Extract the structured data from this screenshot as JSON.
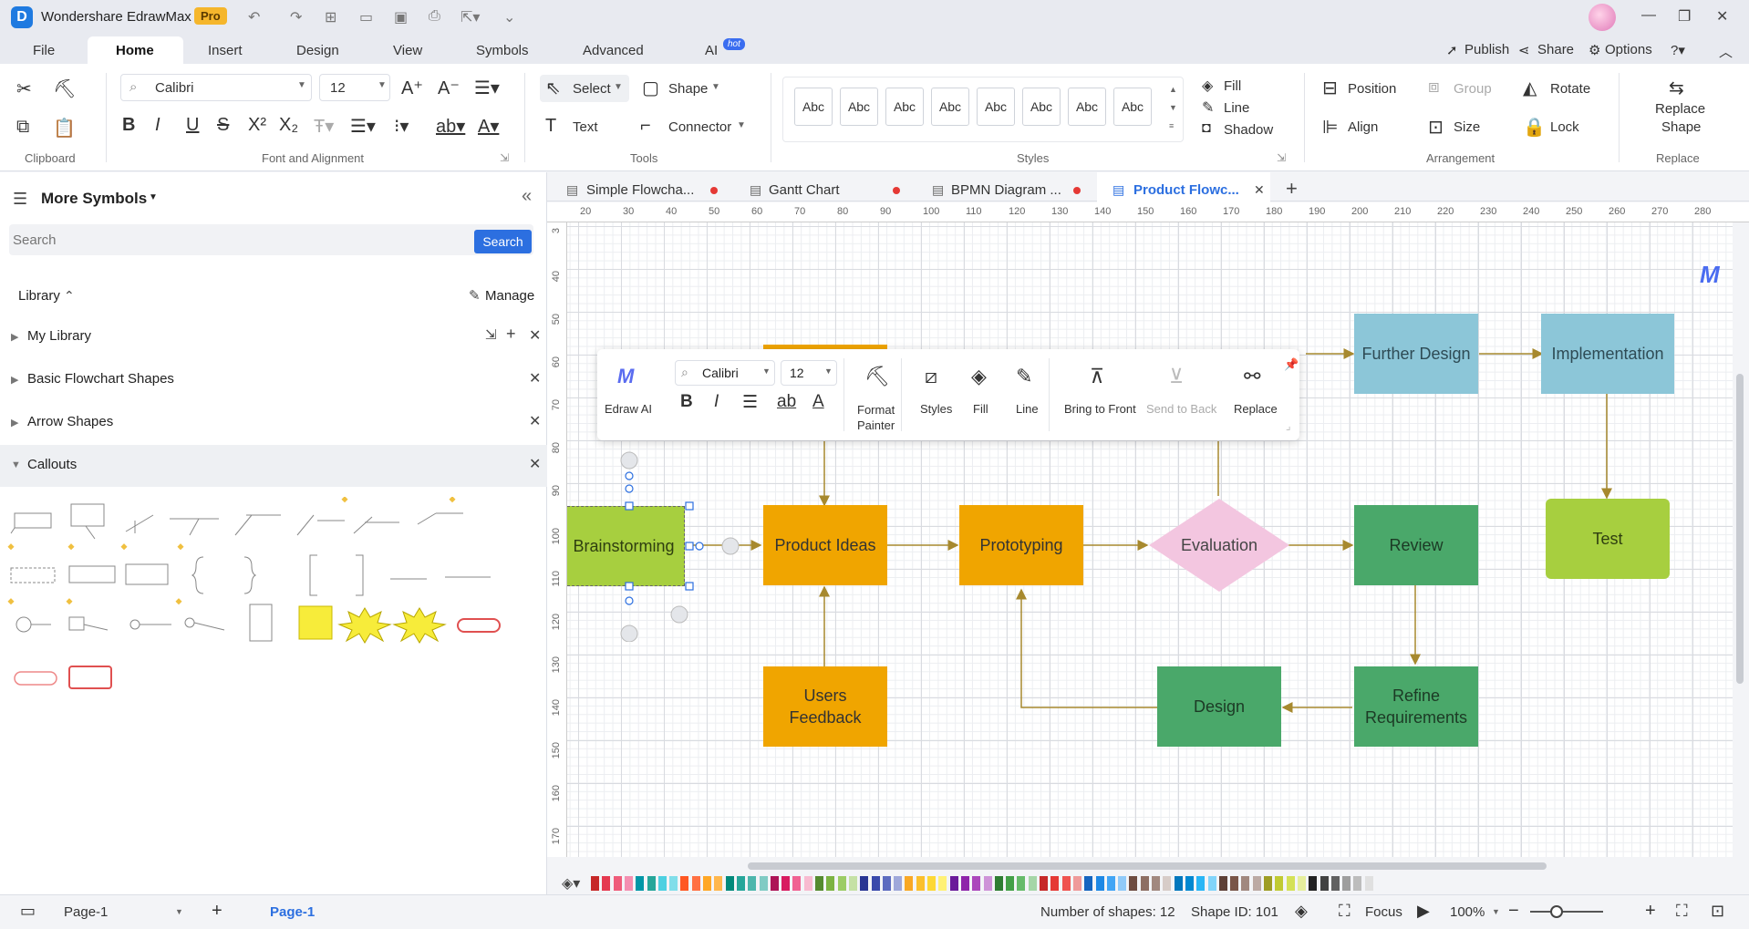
{
  "app": {
    "title": "Wondershare EdrawMax",
    "badge": "Pro"
  },
  "menu": {
    "tabs": [
      "File",
      "Home",
      "Insert",
      "Design",
      "View",
      "Symbols",
      "Advanced",
      "AI"
    ],
    "ai_badge": "hot",
    "publish": "Publish",
    "share": "Share",
    "options": "Options"
  },
  "ribbon": {
    "font_name": "Calibri",
    "font_size": "12",
    "select_label": "Select",
    "shape_label": "Shape",
    "text_label": "Text",
    "connector_label": "Connector",
    "style_sample": "Abc",
    "fill_label": "Fill",
    "line_label": "Line",
    "shadow_label": "Shadow",
    "position_label": "Position",
    "group_label": "Group",
    "rotate_label": "Rotate",
    "align_label": "Align",
    "size_label": "Size",
    "lock_label": "Lock",
    "replace_shape_1": "Replace",
    "replace_shape_2": "Shape",
    "groups": {
      "clipboard": "Clipboard",
      "font": "Font and Alignment",
      "tools": "Tools",
      "styles": "Styles",
      "arrangement": "Arrangement",
      "replace": "Replace"
    }
  },
  "left_panel": {
    "title": "More Symbols",
    "search_placeholder": "Search",
    "search_button": "Search",
    "library_label": "Library",
    "manage_label": "Manage",
    "items": [
      {
        "label": "My Library"
      },
      {
        "label": "Basic Flowchart Shapes"
      },
      {
        "label": "Arrow Shapes"
      },
      {
        "label": "Callouts"
      }
    ]
  },
  "doc_tabs": [
    {
      "label": "Simple Flowcha..."
    },
    {
      "label": "Gantt Chart"
    },
    {
      "label": "BPMN Diagram ..."
    },
    {
      "label": "Product Flowc..."
    }
  ],
  "ruler": {
    "h": [
      "20",
      "30",
      "40",
      "50",
      "60",
      "70",
      "80",
      "90",
      "100",
      "110",
      "120",
      "130",
      "140",
      "150",
      "160",
      "170",
      "180",
      "190",
      "200",
      "210",
      "220",
      "230",
      "240",
      "250",
      "260",
      "270",
      "280"
    ],
    "v": [
      "3",
      "40",
      "50",
      "60",
      "70",
      "80",
      "90",
      "100",
      "110",
      "120",
      "130",
      "140",
      "150",
      "160",
      "170"
    ]
  },
  "floating_toolbar": {
    "edraw_ai": "Edraw AI",
    "font_name": "Calibri",
    "font_size": "12",
    "format_painter_1": "Format",
    "format_painter_2": "Painter",
    "styles": "Styles",
    "fill": "Fill",
    "line": "Line",
    "bring_to_front": "Bring to Front",
    "send_to_back": "Send to Back",
    "replace": "Replace"
  },
  "flowchart": {
    "nodes": {
      "brainstorming": "Brainstorming",
      "product_ideas": "Product Ideas",
      "prototyping": "Prototyping",
      "evaluation": "Evaluation",
      "review": "Review",
      "further_design": "Further Design",
      "implementation": "Implementation",
      "test": "Test",
      "users_feedback_1": "Users",
      "users_feedback_2": "Feedback",
      "design": "Design",
      "refine_1": "Refine",
      "refine_2": "Requirements"
    },
    "colors": {
      "orange": "#f0a500",
      "green": "#4aa86a",
      "blue": "#8cc6d8",
      "lime": "#a7cf3f",
      "pink": "#f3c6e0"
    }
  },
  "status": {
    "page_selector": "Page-1",
    "active_page": "Page-1",
    "shape_count": "Number of shapes: 12",
    "shape_id": "Shape ID: 101",
    "focus": "Focus",
    "zoom": "100%"
  }
}
